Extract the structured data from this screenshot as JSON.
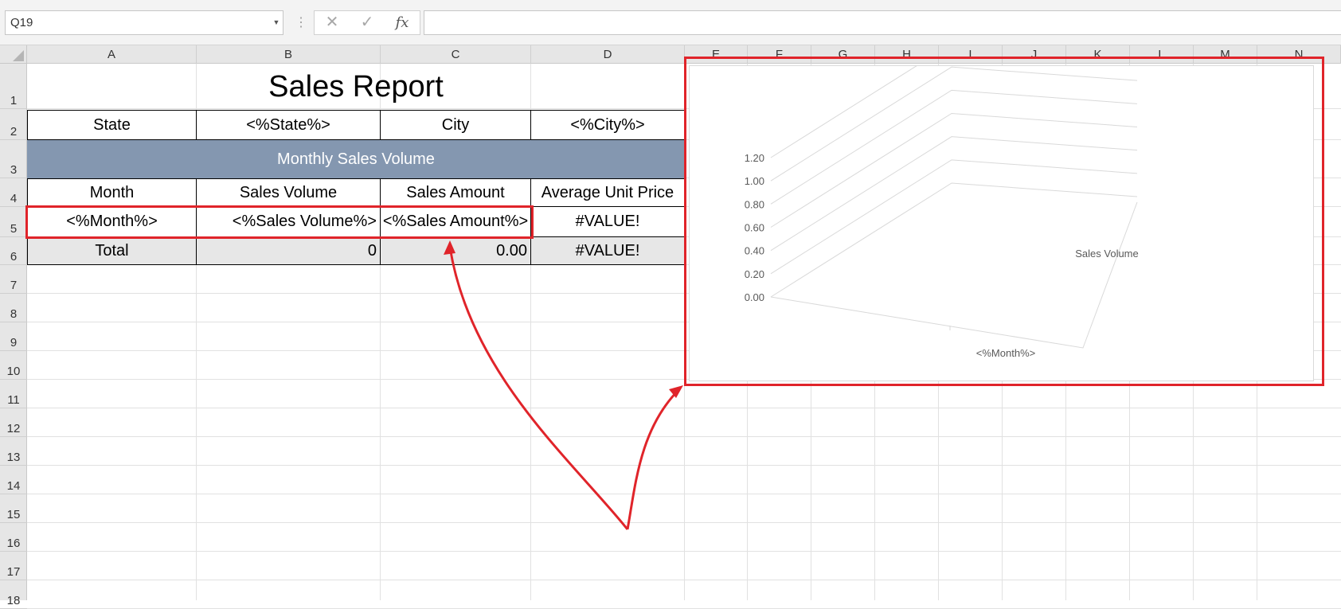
{
  "formula_bar": {
    "name_box": "Q19",
    "separator": "⋮",
    "cancel_icon": "✕",
    "enter_icon": "✓",
    "fx_label": "fx",
    "formula": ""
  },
  "columns": [
    "A",
    "B",
    "C",
    "D",
    "E",
    "F",
    "G",
    "H",
    "I",
    "J",
    "K",
    "L",
    "M",
    "N"
  ],
  "rows": [
    "1",
    "2",
    "3",
    "4",
    "5",
    "6",
    "7",
    "8",
    "9",
    "10",
    "11",
    "12",
    "13",
    "14",
    "15",
    "16",
    "17",
    "18"
  ],
  "report": {
    "title": "Sales Report",
    "state_label": "State",
    "state_value": "<%State%>",
    "city_label": "City",
    "city_value": "<%City%>",
    "section_title": "Monthly Sales Volume",
    "headers": [
      "Month",
      "Sales Volume",
      "Sales Amount",
      "Average Unit Price"
    ],
    "data_row": [
      "<%Month%>",
      "<%Sales Volume%>",
      "<%Sales Amount%>",
      "#VALUE!"
    ],
    "total_row": [
      "Total",
      "0",
      "0.00",
      "#VALUE!"
    ]
  },
  "chart_data": {
    "type": "bar",
    "style": "3d-column",
    "categories": [
      "<%Month%>"
    ],
    "series": [
      {
        "name": "Sales Volume",
        "values": [
          0
        ]
      }
    ],
    "y_ticks": [
      "0.00",
      "0.20",
      "0.40",
      "0.60",
      "0.80",
      "1.00",
      "1.20"
    ],
    "ylim": [
      0,
      1.2
    ],
    "xlabel": "<%Month%>",
    "depth_label": "Sales Volume",
    "grid": true
  },
  "annotation": {
    "highlight_color": "#e0242a"
  }
}
